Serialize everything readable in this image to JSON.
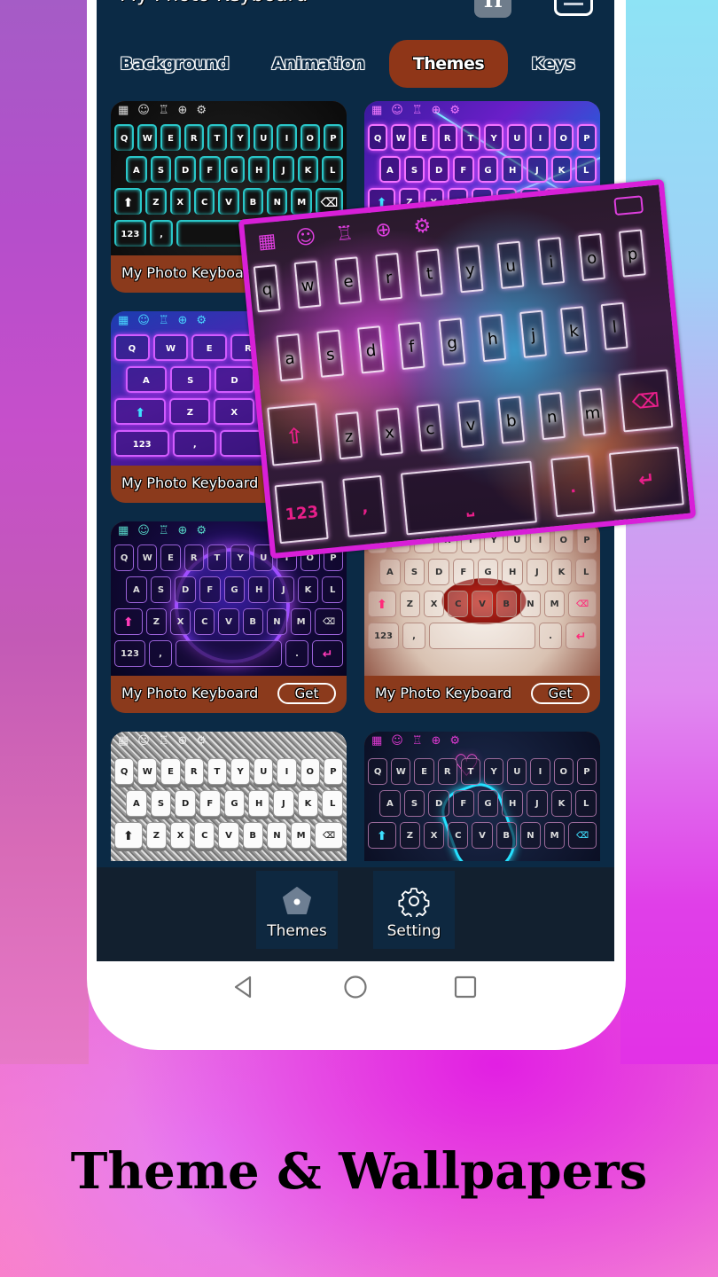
{
  "app": {
    "title": "My Photo Keyboard",
    "font_button": "Tr",
    "colors": {
      "screen_bg": "#0b2a45",
      "active_tab": "#8f3618",
      "card_footer": "#8b3a1c",
      "overlay_border": "#d81fd8",
      "bottom_nav_bg": "#12202f"
    }
  },
  "tabs": [
    {
      "label": "Background",
      "active": false
    },
    {
      "label": "Animation",
      "active": false
    },
    {
      "label": "Themes",
      "active": true
    },
    {
      "label": "Keys",
      "active": false
    }
  ],
  "keyboard": {
    "toolbar_icons": [
      "apps-icon",
      "emoji-icon",
      "shirt-icon",
      "globe-icon",
      "gear-icon"
    ],
    "row1": [
      "Q",
      "W",
      "E",
      "R",
      "T",
      "Y",
      "U",
      "I",
      "O",
      "P"
    ],
    "row2": [
      "A",
      "S",
      "D",
      "F",
      "G",
      "H",
      "J",
      "K",
      "L"
    ],
    "row3": [
      "Z",
      "X",
      "C",
      "V",
      "B",
      "N",
      "M"
    ],
    "shift": "⬆",
    "backspace": "⌫",
    "numbers": "123",
    "comma": ",",
    "period": ".",
    "enter": "↵"
  },
  "themes": [
    {
      "name": "My Photo Keyboard",
      "style": "cyan-neon",
      "button": ""
    },
    {
      "name": "",
      "style": "laser-neon",
      "button": ""
    },
    {
      "name": "My Photo Keyboard",
      "style": "neon-purple",
      "button": ""
    },
    {
      "name": "",
      "style": "hidden",
      "button": ""
    },
    {
      "name": "My Photo Keyboard",
      "style": "neon-ring",
      "button": "Get"
    },
    {
      "name": "My Photo Keyboard",
      "style": "red-bow",
      "button": "Get"
    },
    {
      "name": "",
      "style": "silver-glitter",
      "button": ""
    },
    {
      "name": "",
      "style": "neon-heart-hand",
      "button": ""
    }
  ],
  "preview": {
    "style": "neon-lion",
    "row1": [
      "q",
      "w",
      "e",
      "r",
      "t",
      "y",
      "u",
      "i",
      "o",
      "p"
    ],
    "row2": [
      "a",
      "s",
      "d",
      "f",
      "g",
      "h",
      "j",
      "k",
      "l"
    ],
    "row3": [
      "z",
      "x",
      "c",
      "v",
      "b",
      "n",
      "m"
    ],
    "numbers": "123",
    "comma": ",",
    "period": "."
  },
  "bottom_nav": [
    {
      "label": "Themes",
      "icon": "home-pentagon-icon",
      "active": true
    },
    {
      "label": "Setting",
      "icon": "gear-icon",
      "active": false
    }
  ],
  "system_nav": [
    "back-icon",
    "home-icon",
    "recents-icon"
  ],
  "caption": "Theme & Wallpapers"
}
